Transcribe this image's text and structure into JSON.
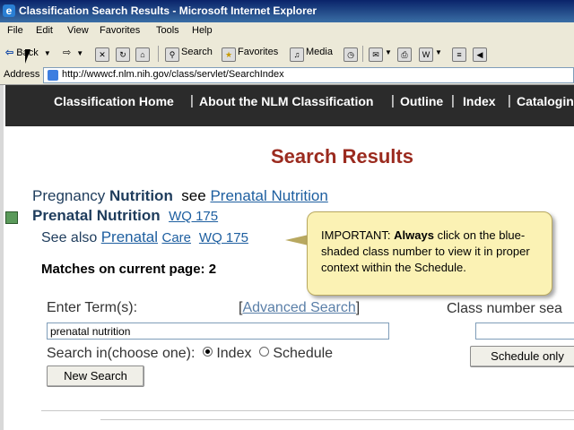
{
  "window": {
    "title": "Classification Search Results - Microsoft Internet Explorer"
  },
  "menu": [
    "File",
    "Edit",
    "View",
    "Favorites",
    "Tools",
    "Help"
  ],
  "toolbar": {
    "back": "Back",
    "search": "Search",
    "favorites": "Favorites",
    "media": "Media"
  },
  "address": {
    "label": "Address",
    "url": "http://wwwcf.nlm.nih.gov/class/servlet/SearchIndex"
  },
  "nav": {
    "items": [
      "Classification Home",
      "About the NLM Classification",
      "Outline",
      "Index",
      "Cataloging"
    ]
  },
  "page": {
    "heading": "Search Results",
    "result1": {
      "pre": "Pregnancy",
      "bold": "Nutrition",
      "see": "see",
      "link": "Prenatal Nutrition"
    },
    "result2": {
      "term": "Prenatal Nutrition",
      "code": "WQ 175"
    },
    "see_also": {
      "label": "See also",
      "link1": "Prenatal",
      "link2": "Care",
      "code": "WQ 175"
    },
    "matches": "Matches on current page: 2"
  },
  "callout": {
    "important": "IMPORTANT:",
    "always": "Always",
    "text": "click on the blue-shaded class number to view it in proper context within the Schedule."
  },
  "form": {
    "enter_term_label": "Enter Term(s):",
    "advanced_open": "[",
    "advanced_link": "Advanced Search",
    "advanced_close": "]",
    "term_value": "prenatal nutrition",
    "search_in_label": "Search in(choose one):",
    "radio_index": "Index",
    "radio_schedule": "Schedule",
    "new_search": "New Search",
    "class_number_label": "Class number sea",
    "schedule_only": "Schedule only"
  }
}
